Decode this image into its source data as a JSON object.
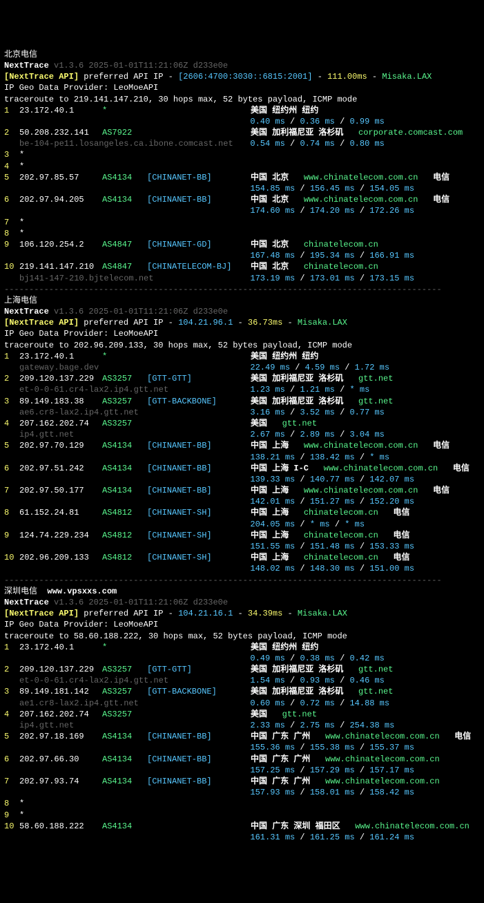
{
  "sections": [
    {
      "title": "北京电信",
      "site": "",
      "banner": {
        "name": "NextTrace",
        "ver": "v1.3.6 2025-01-01T11:21:06Z d233e0e"
      },
      "api": {
        "label": "[NextTrace API]",
        "text": " preferred API IP - ",
        "ip": "[2606:4700:3030::6815:2001]",
        "lat": "111.00ms",
        "pop": "Misaka.LAX"
      },
      "provider": "IP Geo Data Provider: LeoMoeAPI",
      "cmd": "traceroute to 219.141.147.210, 30 hops max, 52 bytes payload, ICMP mode",
      "hops": [
        {
          "n": "1",
          "ip": "23.172.40.1",
          "as": "*",
          "net": "",
          "loc": "美国 纽约州 纽约",
          "host": "",
          "isp": "",
          "sub": "",
          "lat": "0.40 ms / 0.36 ms / 0.99 ms"
        },
        {
          "n": "2",
          "ip": "50.208.232.141",
          "as": "AS7922",
          "net": "",
          "loc": "美国 加利福尼亚 洛杉矶",
          "host": "corporate.comcast.com",
          "isp": "",
          "sub": "be-104-pe11.losangeles.ca.ibone.comcast.net",
          "lat": "0.54 ms / 0.74 ms / 0.80 ms"
        },
        {
          "n": "3",
          "ip": "*",
          "as": "",
          "net": "",
          "loc": "",
          "host": "",
          "isp": "",
          "sub": "",
          "lat": ""
        },
        {
          "n": "4",
          "ip": "*",
          "as": "",
          "net": "",
          "loc": "",
          "host": "",
          "isp": "",
          "sub": "",
          "lat": ""
        },
        {
          "n": "5",
          "ip": "202.97.85.57",
          "as": "AS4134",
          "net": "[CHINANET-BB]",
          "loc": "中国 北京",
          "host": "www.chinatelecom.com.cn",
          "isp": "电信",
          "sub": "",
          "lat": "154.85 ms / 156.45 ms / 154.05 ms"
        },
        {
          "n": "6",
          "ip": "202.97.94.205",
          "as": "AS4134",
          "net": "[CHINANET-BB]",
          "loc": "中国 北京",
          "host": "www.chinatelecom.com.cn",
          "isp": "电信",
          "sub": "",
          "lat": "174.60 ms / 174.20 ms / 172.26 ms"
        },
        {
          "n": "7",
          "ip": "*",
          "as": "",
          "net": "",
          "loc": "",
          "host": "",
          "isp": "",
          "sub": "",
          "lat": ""
        },
        {
          "n": "8",
          "ip": "*",
          "as": "",
          "net": "",
          "loc": "",
          "host": "",
          "isp": "",
          "sub": "",
          "lat": ""
        },
        {
          "n": "9",
          "ip": "106.120.254.2",
          "as": "AS4847",
          "net": "[CHINANET-GD]",
          "loc": "中国 北京",
          "host": "chinatelecom.cn",
          "isp": "",
          "sub": "",
          "lat": "167.48 ms / 195.34 ms / 166.91 ms"
        },
        {
          "n": "10",
          "ip": "219.141.147.210",
          "as": "AS4847",
          "net": "[CHINATELECOM-BJ]",
          "loc": "中国 北京",
          "host": "chinatelecom.cn",
          "isp": "",
          "sub": "bj141-147-210.bjtelecom.net",
          "lat": "173.19 ms / 173.01 ms / 173.15 ms"
        }
      ]
    },
    {
      "title": "上海电信",
      "site": "",
      "banner": {
        "name": "NextTrace",
        "ver": "v1.3.6 2025-01-01T11:21:06Z d233e0e"
      },
      "api": {
        "label": "[NextTrace API]",
        "text": " preferred API IP - ",
        "ip": "104.21.96.1",
        "lat": "36.73ms",
        "pop": "Misaka.LAX"
      },
      "provider": "IP Geo Data Provider: LeoMoeAPI",
      "cmd": "traceroute to 202.96.209.133, 30 hops max, 52 bytes payload, ICMP mode",
      "hops": [
        {
          "n": "1",
          "ip": "23.172.40.1",
          "as": "*",
          "net": "",
          "loc": "美国 纽约州 纽约",
          "host": "",
          "isp": "",
          "sub": "gateway.bage.dev",
          "lat": "22.49 ms / 4.59 ms / 1.72 ms"
        },
        {
          "n": "2",
          "ip": "209.120.137.229",
          "as": "AS3257",
          "net": "[GTT-GTT]",
          "loc": "美国 加利福尼亚 洛杉矶",
          "host": "gtt.net",
          "isp": "",
          "sub": "et-0-0-61.cr4-lax2.ip4.gtt.net",
          "lat": "1.23 ms / 1.21 ms / * ms"
        },
        {
          "n": "3",
          "ip": "89.149.183.38",
          "as": "AS3257",
          "net": "[GTT-BACKBONE]",
          "loc": "美国 加利福尼亚 洛杉矶",
          "host": "gtt.net",
          "isp": "",
          "sub": "ae6.cr8-lax2.ip4.gtt.net",
          "lat": "3.16 ms / 3.52 ms / 0.77 ms"
        },
        {
          "n": "4",
          "ip": "207.162.202.74",
          "as": "AS3257",
          "net": "",
          "loc": "美国",
          "host": "gtt.net",
          "isp": "",
          "sub": "ip4.gtt.net",
          "lat": "2.67 ms / 2.89 ms / 3.04 ms"
        },
        {
          "n": "5",
          "ip": "202.97.70.129",
          "as": "AS4134",
          "net": "[CHINANET-BB]",
          "loc": "中国 上海",
          "host": "www.chinatelecom.com.cn",
          "isp": "电信",
          "sub": "",
          "lat": "138.21 ms / 138.42 ms / * ms"
        },
        {
          "n": "6",
          "ip": "202.97.51.242",
          "as": "AS4134",
          "net": "[CHINANET-BB]",
          "loc": "中国 上海 I-C",
          "host": "www.chinatelecom.com.cn",
          "isp": "电信",
          "sub": "",
          "lat": "139.33 ms / 140.77 ms / 142.07 ms"
        },
        {
          "n": "7",
          "ip": "202.97.50.177",
          "as": "AS4134",
          "net": "[CHINANET-BB]",
          "loc": "中国 上海",
          "host": "www.chinatelecom.com.cn",
          "isp": "电信",
          "sub": "",
          "lat": "142.01 ms / 151.27 ms / 152.20 ms"
        },
        {
          "n": "8",
          "ip": "61.152.24.81",
          "as": "AS4812",
          "net": "[CHINANET-SH]",
          "loc": "中国 上海",
          "host": "chinatelecom.cn",
          "isp": "电信",
          "sub": "",
          "lat": "204.05 ms / * ms / * ms"
        },
        {
          "n": "9",
          "ip": "124.74.229.234",
          "as": "AS4812",
          "net": "[CHINANET-SH]",
          "loc": "中国 上海",
          "host": "chinatelecom.cn",
          "isp": "电信",
          "sub": "",
          "lat": "151.55 ms / 151.48 ms / 153.33 ms"
        },
        {
          "n": "10",
          "ip": "202.96.209.133",
          "as": "AS4812",
          "net": "[CHINANET-SH]",
          "loc": "中国 上海",
          "host": "chinatelecom.cn",
          "isp": "电信",
          "sub": "",
          "lat": "148.02 ms / 148.30 ms / 151.00 ms"
        }
      ]
    },
    {
      "title": "深圳电信",
      "site": "www.vpsxxs.com",
      "banner": {
        "name": "NextTrace",
        "ver": "v1.3.6 2025-01-01T11:21:06Z d233e0e"
      },
      "api": {
        "label": "[NextTrace API]",
        "text": " preferred API IP - ",
        "ip": "104.21.16.1",
        "lat": "34.39ms",
        "pop": "Misaka.LAX"
      },
      "provider": "IP Geo Data Provider: LeoMoeAPI",
      "cmd": "traceroute to 58.60.188.222, 30 hops max, 52 bytes payload, ICMP mode",
      "hops": [
        {
          "n": "1",
          "ip": "23.172.40.1",
          "as": "*",
          "net": "",
          "loc": "美国 纽约州 纽约",
          "host": "",
          "isp": "",
          "sub": "",
          "lat": "0.49 ms / 0.38 ms / 0.42 ms"
        },
        {
          "n": "2",
          "ip": "209.120.137.229",
          "as": "AS3257",
          "net": "[GTT-GTT]",
          "loc": "美国 加利福尼亚 洛杉矶",
          "host": "gtt.net",
          "isp": "",
          "sub": "et-0-0-61.cr4-lax2.ip4.gtt.net",
          "lat": "1.54 ms / 0.93 ms / 0.46 ms"
        },
        {
          "n": "3",
          "ip": "89.149.181.142",
          "as": "AS3257",
          "net": "[GTT-BACKBONE]",
          "loc": "美国 加利福尼亚 洛杉矶",
          "host": "gtt.net",
          "isp": "",
          "sub": "ae1.cr8-lax2.ip4.gtt.net",
          "lat": "0.60 ms / 0.72 ms / 14.88 ms"
        },
        {
          "n": "4",
          "ip": "207.162.202.74",
          "as": "AS3257",
          "net": "",
          "loc": "美国",
          "host": "gtt.net",
          "isp": "",
          "sub": "ip4.gtt.net",
          "lat": "2.33 ms / 2.75 ms / 254.38 ms"
        },
        {
          "n": "5",
          "ip": "202.97.18.169",
          "as": "AS4134",
          "net": "[CHINANET-BB]",
          "loc": "中国 广东 广州",
          "host": "www.chinatelecom.com.cn",
          "isp": "电信",
          "sub": "",
          "lat": "155.36 ms / 155.38 ms / 155.37 ms"
        },
        {
          "n": "6",
          "ip": "202.97.66.30",
          "as": "AS4134",
          "net": "[CHINANET-BB]",
          "loc": "中国 广东 广州",
          "host": "www.chinatelecom.com.cn",
          "isp": "",
          "sub": "",
          "lat": "157.25 ms / 157.29 ms / 157.17 ms"
        },
        {
          "n": "7",
          "ip": "202.97.93.74",
          "as": "AS4134",
          "net": "[CHINANET-BB]",
          "loc": "中国 广东 广州",
          "host": "www.chinatelecom.com.cn",
          "isp": "",
          "sub": "",
          "lat": "157.93 ms / 158.01 ms / 158.42 ms"
        },
        {
          "n": "8",
          "ip": "*",
          "as": "",
          "net": "",
          "loc": "",
          "host": "",
          "isp": "",
          "sub": "",
          "lat": ""
        },
        {
          "n": "9",
          "ip": "*",
          "as": "",
          "net": "",
          "loc": "",
          "host": "",
          "isp": "",
          "sub": "",
          "lat": ""
        },
        {
          "n": "10",
          "ip": "58.60.188.222",
          "as": "AS4134",
          "net": "",
          "loc": "中国 广东 深圳 福田区",
          "host": "www.chinatelecom.com.cn",
          "isp": "电信",
          "sub": "",
          "lat": "161.31 ms / 161.25 ms / 161.24 ms"
        }
      ]
    }
  ],
  "dashes": "----------------------------------------------------------------------------------------"
}
